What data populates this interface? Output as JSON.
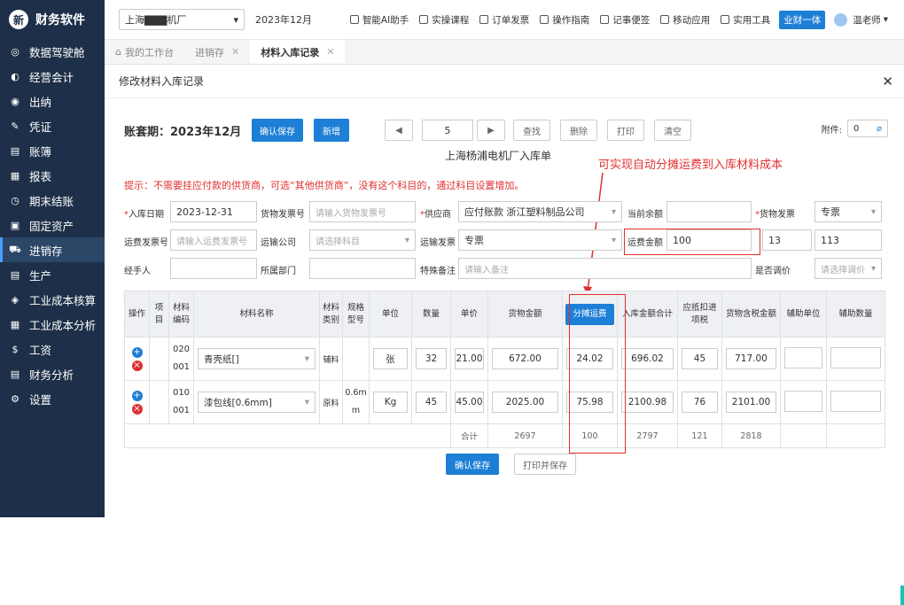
{
  "app": {
    "name": "财务软件",
    "logo_glyph": "新"
  },
  "sidebar": {
    "items": [
      {
        "label": "数据驾驶舱",
        "icon": "dashboard-icon",
        "glyph": "◎"
      },
      {
        "label": "经营会计",
        "icon": "chart-icon",
        "glyph": "◐"
      },
      {
        "label": "出纳",
        "icon": "cashier-icon",
        "glyph": "◉"
      },
      {
        "label": "凭证",
        "icon": "voucher-icon",
        "glyph": "✎"
      },
      {
        "label": "账簿",
        "icon": "ledger-icon",
        "glyph": "▤"
      },
      {
        "label": "报表",
        "icon": "report-icon",
        "glyph": "▦"
      },
      {
        "label": "期末结账",
        "icon": "closing-icon",
        "glyph": "◷"
      },
      {
        "label": "固定资产",
        "icon": "asset-icon",
        "glyph": "▣"
      },
      {
        "label": "进销存",
        "icon": "cart-icon",
        "glyph": "⛟"
      },
      {
        "label": "生产",
        "icon": "production-icon",
        "glyph": "▤"
      },
      {
        "label": "工业成本核算",
        "icon": "cube-icon",
        "glyph": "◈"
      },
      {
        "label": "工业成本分析",
        "icon": "analysis-icon",
        "glyph": "▦"
      },
      {
        "label": "工资",
        "icon": "dollar-icon",
        "glyph": "$"
      },
      {
        "label": "财务分析",
        "icon": "finance-icon",
        "glyph": "▤"
      },
      {
        "label": "设置",
        "icon": "gear-icon",
        "glyph": "⚙"
      }
    ],
    "active_index": 8
  },
  "topbar": {
    "company": "上海▇▇▇机厂",
    "period": "2023年12月",
    "tools": [
      "智能AI助手",
      "实操课程",
      "订单发票",
      "操作指南",
      "记事便签",
      "移动应用",
      "实用工具"
    ],
    "badge": "业财一体",
    "user": "温老师"
  },
  "tabs": [
    {
      "label": "我的工作台",
      "closable": false,
      "active": false
    },
    {
      "label": "进销存",
      "closable": true,
      "active": false
    },
    {
      "label": "材料入库记录",
      "closable": true,
      "active": true
    }
  ],
  "page_title": "修改材料入库记录",
  "toolbar": {
    "period_label": "账套期：2023年12月",
    "confirm_save": "确认保存",
    "add_new": "新增",
    "prev": "◀",
    "page_number": "5",
    "next": "▶",
    "search": "查找",
    "delete": "删除",
    "print": "打印",
    "clear": "清空",
    "attachment_label": "附件:",
    "attachment_count": "0"
  },
  "voucher_title": "上海杨浦电机厂入库单",
  "annotation": "可实现自动分摊运费到入库材料成本",
  "tip": "提示：不需要挂应付款的供货商，可选“其他供货商”，没有这个科目的，通过科目设置增加。",
  "form": {
    "date_label": "入库日期",
    "date_value": "2023-12-31",
    "invoice_no_label": "货物发票号",
    "invoice_no_ph": "请输入货物发票号",
    "supplier_label": "供应商",
    "supplier_value": "应付账款 浙江塑料制品公司",
    "balance_label": "当前余额",
    "balance_value": "",
    "goods_invoice_label": "货物发票",
    "goods_invoice_value": "专票",
    "freight_invoice_no_label": "运费发票号",
    "freight_invoice_no_ph": "请输入运费发票号",
    "freight_company_label": "运输公司",
    "freight_company_ph": "请选择科目",
    "freight_invoice_label": "运输发票",
    "freight_invoice_value": "专票",
    "freight_amount_label": "运费金额",
    "freight_amount_value": "100",
    "freight_tax": "13",
    "freight_total": "113",
    "handler_label": "经手人",
    "handler_value": "",
    "dept_label": "所属部门",
    "dept_value": "",
    "remark_label": "特殊备注",
    "remark_ph": "请输入备注",
    "adjust_label": "是否调价",
    "adjust_ph": "请选择调价"
  },
  "grid": {
    "headers": [
      "操作",
      "项目",
      "材料编码",
      "材料名称",
      "材料类别",
      "规格型号",
      "单位",
      "数量",
      "单价",
      "货物金额",
      "分摊运费",
      "入库金额合计",
      "应抵扣进项税",
      "货物含税金额",
      "辅助单位",
      "辅助数量"
    ],
    "rows": [
      {
        "code": "020001",
        "name": "青壳纸[]",
        "category": "辅料",
        "spec": "",
        "unit": "张",
        "qty": "32",
        "price": "21.00",
        "amount": "672.00",
        "freight": "24.02",
        "total": "696.02",
        "tax": "45",
        "tax_amount": "717.00"
      },
      {
        "code": "010001",
        "name": "漆包线[0.6mm]",
        "category": "原料",
        "spec": "0.6mm",
        "unit": "Kg",
        "qty": "45",
        "price": "45.00",
        "amount": "2025.00",
        "freight": "75.98",
        "total": "2100.98",
        "tax": "76",
        "tax_amount": "2101.00"
      }
    ],
    "summary": {
      "label": "合计",
      "amount": "2697",
      "freight": "100",
      "total": "2797",
      "tax": "121",
      "tax_amount": "2818"
    }
  },
  "bottom": {
    "confirm_save": "确认保存",
    "print_save": "打印并保存"
  },
  "colors": {
    "sidebar_bg": "#1e3049",
    "primary": "#1e7fd6",
    "alert": "#e03030"
  }
}
